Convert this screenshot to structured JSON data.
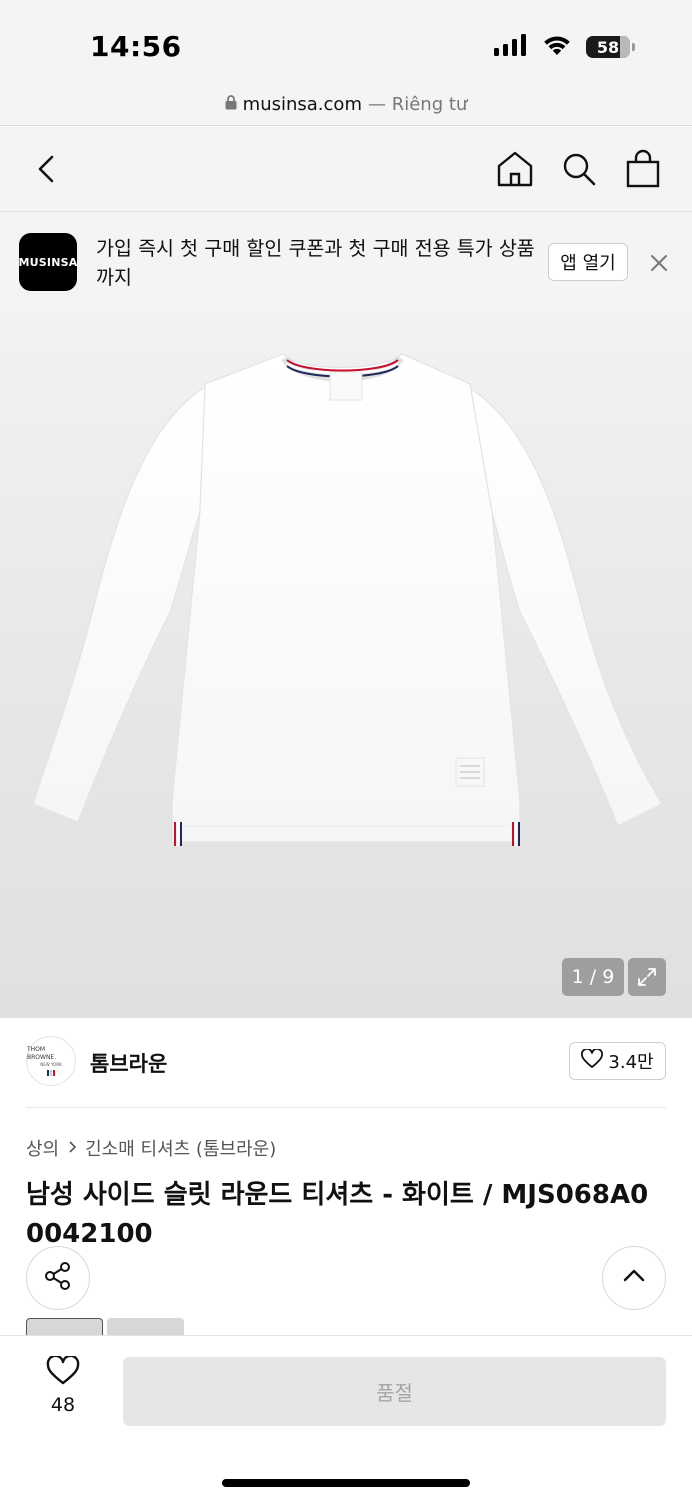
{
  "status_bar": {
    "time": "14:56",
    "battery": "58"
  },
  "browser": {
    "domain": "musinsa.com",
    "private_label": "— Riêng tư"
  },
  "banner": {
    "logo_text": "MUSINSA",
    "message": "가입 즉시 첫 구매 할인 쿠폰과 첫 구매 전용 특가 상품까지",
    "open_app_label": "앱 열기"
  },
  "gallery": {
    "counter": "1 / 9"
  },
  "brand": {
    "name": "톰브라운",
    "logo_line1": "THOM BROWNE.",
    "logo_line2": "NEW YORK",
    "likes": "3.4만"
  },
  "breadcrumb": {
    "level1": "상의",
    "separator": ">",
    "level2": "긴소매 티셔츠 (톰브라운)"
  },
  "product": {
    "title": "남성 사이드 슬릿 라운드 티셔츠 - 화이트 / MJS068A00042100"
  },
  "bottom_bar": {
    "like_count": "48",
    "buy_label": "품절"
  },
  "colors": {
    "accent_red": "#c8102e",
    "accent_navy": "#1f2a5c",
    "soldout_bg": "#e6e6e6"
  }
}
